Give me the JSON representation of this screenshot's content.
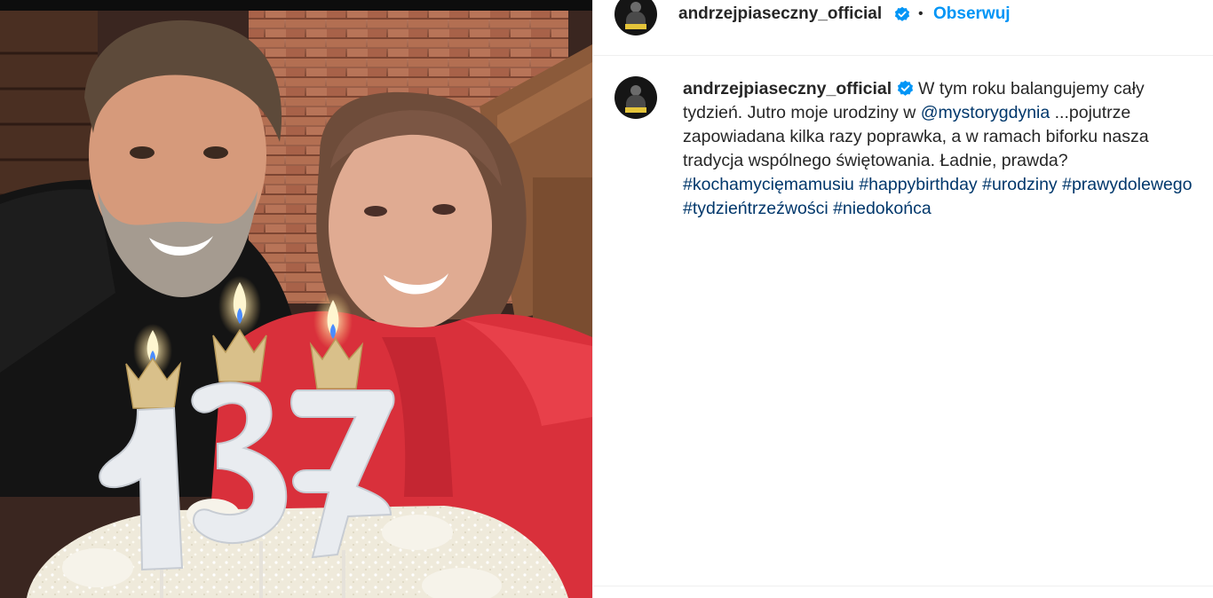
{
  "post": {
    "username": "andrzejpiaseczny_official",
    "separator": "•",
    "follow_label": "Obserwuj",
    "verified_icon": "verified-badge-icon",
    "accent_color": "#0095f6",
    "link_color": "#00376b"
  },
  "caption": {
    "username": "andrzejpiaseczny_official",
    "text_1": "W tym roku balangujemy cały tydzień. Jutro moje urodziny w",
    "mention": "@mystorygdynia",
    "text_2": "...pojutrze zapowiadana kilka razy poprawka, a w ramach biforku nasza tradycja wspólnego świętowania. Ładnie, prawda?",
    "hashtags": [
      "#kochamycięmamusiu",
      "#happybirthday",
      "#urodziny",
      "#prawydolewego",
      "#tydzieńtrzeźwości",
      "#niedokońca"
    ]
  },
  "photo": {
    "description_alt": "",
    "candle_digits": [
      "1",
      "3",
      "7"
    ]
  }
}
